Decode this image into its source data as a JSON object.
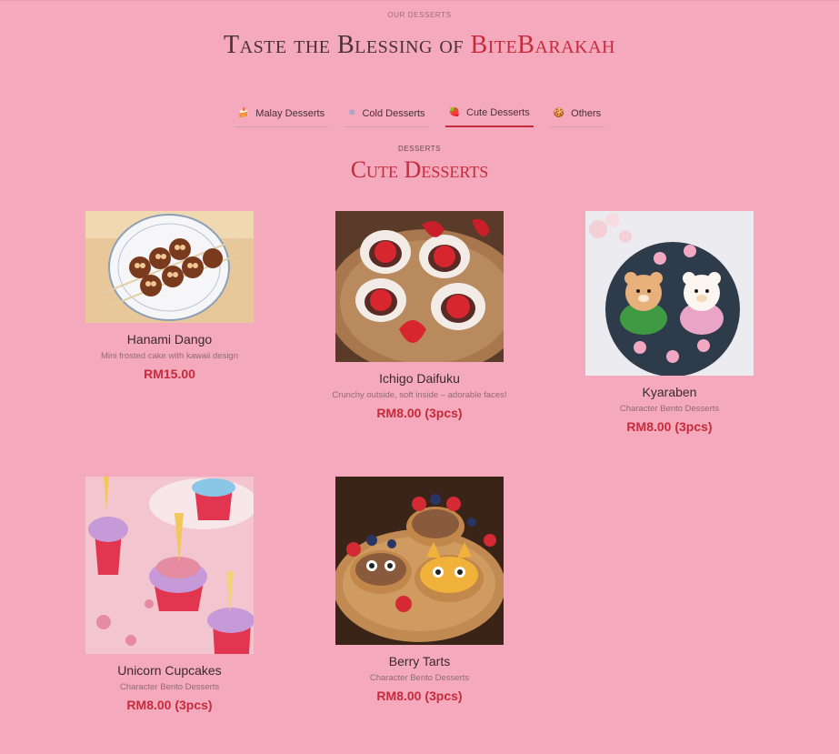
{
  "header": {
    "eyebrow": "OUR DESSERTS",
    "title_prefix": "Taste the Blessing of ",
    "title_brand": "BiteBarakah"
  },
  "tabs": [
    {
      "label": "Malay Desserts",
      "icon": "cake-icon",
      "glyph": "🍰",
      "active": false
    },
    {
      "label": "Cold Desserts",
      "icon": "snowflake-icon",
      "glyph": "❄",
      "active": false
    },
    {
      "label": "Cute Desserts",
      "icon": "strawberry-icon",
      "glyph": "🍓",
      "active": true
    },
    {
      "label": "Others",
      "icon": "cookie-icon",
      "glyph": "🍪",
      "active": false
    }
  ],
  "section": {
    "eyebrow": "DESSERTS",
    "title": "Cute Desserts"
  },
  "products": [
    {
      "name": "Hanami Dango",
      "description": "Mini frosted cake with kawaii design",
      "price": "RM15.00",
      "image": "skewered-dango-photo"
    },
    {
      "name": "Ichigo Daifuku",
      "description": "Crunchy outside, soft inside – adorable faces!",
      "price": "RM8.00 (3pcs)",
      "image": "strawberry-daifuku-photo"
    },
    {
      "name": "Kyaraben",
      "description": "Character Bento Desserts",
      "price": "RM8.00 (3pcs)",
      "image": "character-bento-photo"
    },
    {
      "name": "Unicorn Cupcakes",
      "description": "Character Bento Desserts",
      "price": "RM8.00 (3pcs)",
      "image": "unicorn-cupcake-photo"
    },
    {
      "name": "Berry Tarts",
      "description": "Character Bento Desserts",
      "price": "RM8.00 (3pcs)",
      "image": "berry-tart-photo"
    }
  ],
  "colors": {
    "background": "#f4a9bc",
    "accent": "#c62b3b",
    "text": "#3a2a2f"
  }
}
